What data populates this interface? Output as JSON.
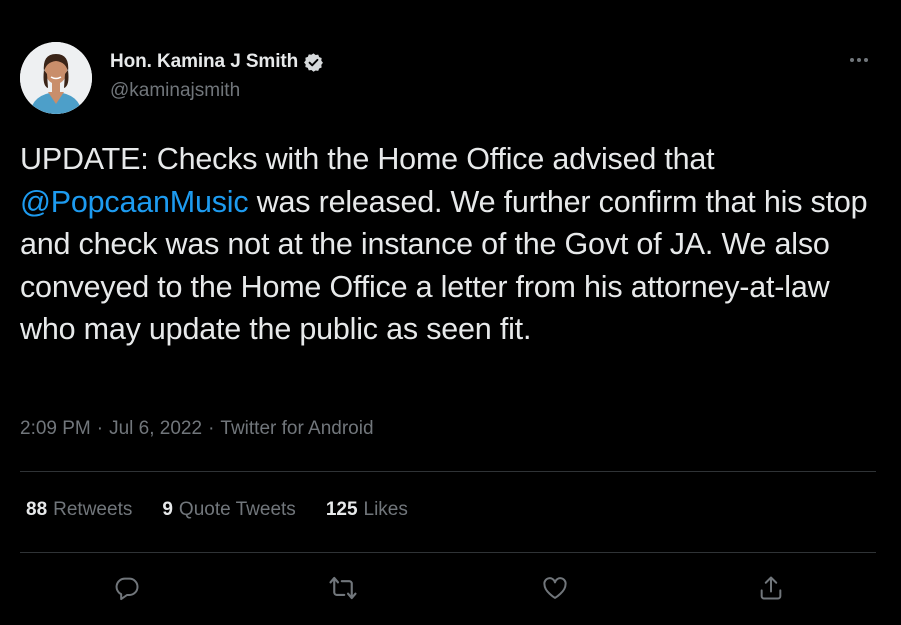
{
  "author": {
    "display_name": "Hon. Kamina J Smith",
    "handle": "@kaminajsmith",
    "verified": true,
    "avatar_icon": "profile-photo"
  },
  "tweet": {
    "text_before_mention": "UPDATE: Checks with the Home Office advised that\n",
    "mention": "@PopcaanMusic",
    "text_after_mention": " was released. We further confirm that his stop and check was not at the instance of the Govt of JA. We also conveyed to the Home Office a letter from his attorney-at-law who may update the public as seen fit."
  },
  "meta": {
    "time": "2:09 PM",
    "date": "Jul 6, 2022",
    "separator": "·",
    "source": "Twitter for Android"
  },
  "stats": {
    "retweets_count": "88",
    "retweets_label": "Retweets",
    "quotes_count": "9",
    "quotes_label": "Quote Tweets",
    "likes_count": "125",
    "likes_label": "Likes"
  },
  "actions": [
    "reply-icon",
    "retweet-icon",
    "like-icon",
    "share-icon"
  ],
  "colors": {
    "background": "#000000",
    "text": "#e7e9ea",
    "secondary": "#71767b",
    "link": "#1d9bf0",
    "divider": "#2f3336"
  }
}
